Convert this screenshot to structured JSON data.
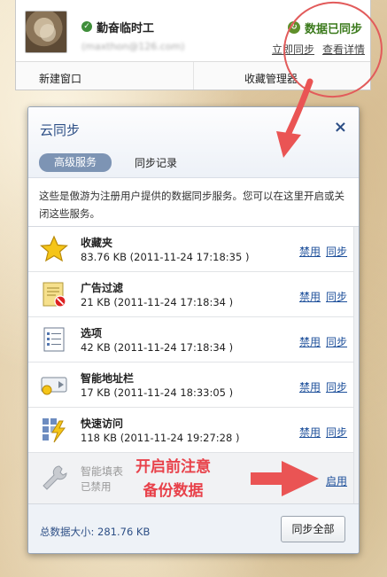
{
  "account": {
    "user_name": "勤奋临时工",
    "user_email": "(maxthon@126.com)",
    "sync_status": "数据已同步",
    "sync_now": "立即同步",
    "view_details": "查看详情",
    "new_window": "新建窗口",
    "favorites_manager": "收藏管理器"
  },
  "dialog": {
    "title": "云同步",
    "close": "×",
    "tabs": [
      {
        "label": "高级服务",
        "active": true
      },
      {
        "label": "同步记录",
        "active": false
      }
    ],
    "description": "这些是傲游为注册用户提供的数据同步服务。您可以在这里开启或关闭这些服务。",
    "services": [
      {
        "name": "收藏夹",
        "detail": "83.76 KB (2011-11-24 17:18:35 )",
        "icon": "star-icon",
        "disable": "禁用",
        "sync": "同步"
      },
      {
        "name": "广告过滤",
        "detail": "21 KB (2011-11-24 17:18:34 )",
        "icon": "ad-filter-icon",
        "disable": "禁用",
        "sync": "同步"
      },
      {
        "name": "选项",
        "detail": "42 KB (2011-11-24 17:18:34 )",
        "icon": "options-list-icon",
        "disable": "禁用",
        "sync": "同步"
      },
      {
        "name": "智能地址栏",
        "detail": "17 KB (2011-11-24 18:33:05 )",
        "icon": "smart-address-icon",
        "disable": "禁用",
        "sync": "同步"
      },
      {
        "name": "快速访问",
        "detail": "118 KB (2011-11-24 19:27:28 )",
        "icon": "quick-access-icon",
        "disable": "禁用",
        "sync": "同步"
      },
      {
        "name": "智能填表",
        "detail": "已禁用",
        "icon": "wrench-icon",
        "enable": "启用",
        "disabled": true
      }
    ],
    "total_size": "总数据大小: 281.76 KB",
    "sync_all": "同步全部"
  },
  "annotation": {
    "note_line1": "开启前注意",
    "note_line2": "备份数据",
    "color": "#e8414a"
  }
}
